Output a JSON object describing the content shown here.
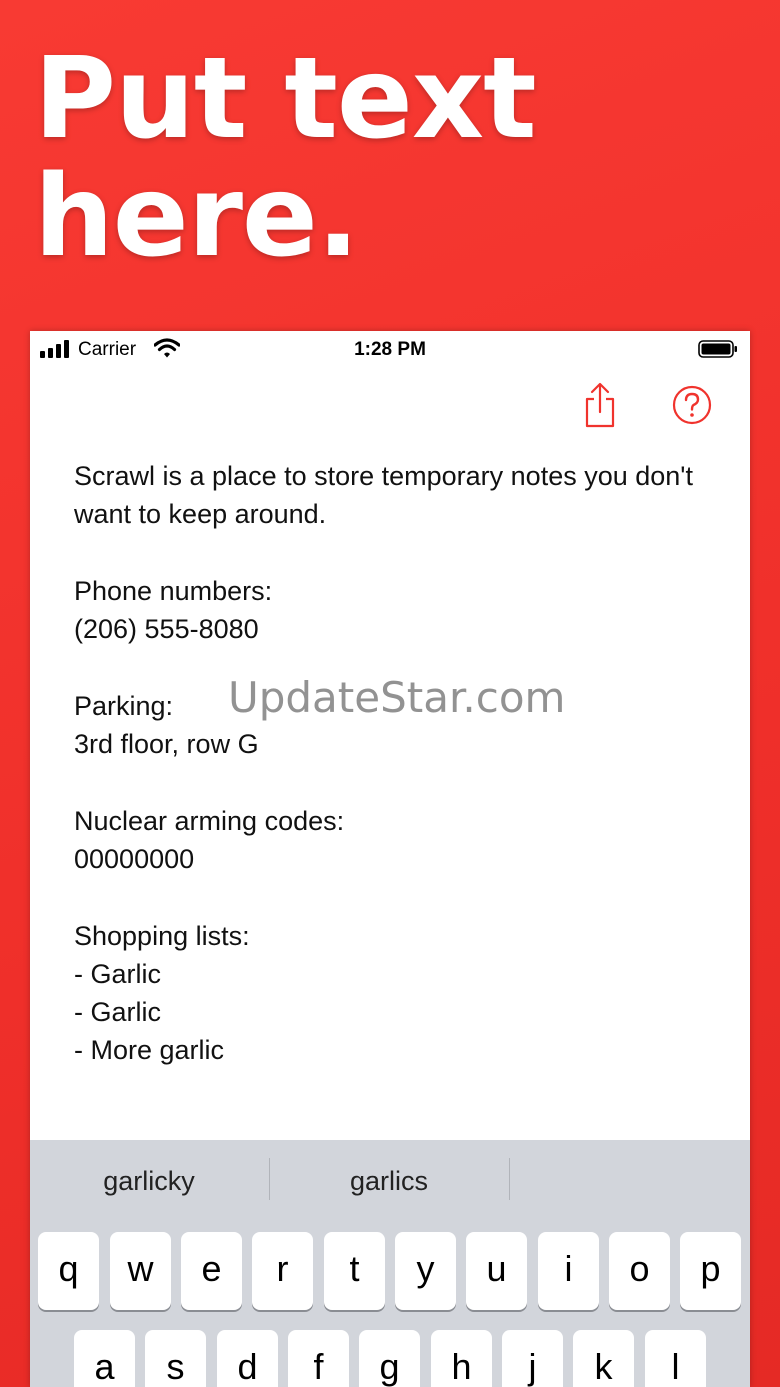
{
  "headline": {
    "line1": "Put text",
    "line2": "here."
  },
  "status_bar": {
    "carrier": "Carrier",
    "time": "1:28 PM"
  },
  "toolbar": {
    "share_icon": "share-icon",
    "help_icon": "help-icon"
  },
  "note": {
    "text": "Scrawl is a place to store temporary notes you don't want to keep around.\n\nPhone numbers:\n(206) 555-8080\n\nParking:\n3rd floor, row G\n\nNuclear arming codes:\n00000000\n\nShopping lists:\n- Garlic\n- Garlic\n- More garlic"
  },
  "watermark": "UpdateStar.com",
  "keyboard": {
    "suggestions": [
      "garlicky",
      "garlics",
      ""
    ],
    "row1": [
      "q",
      "w",
      "e",
      "r",
      "t",
      "y",
      "u",
      "i",
      "o",
      "p"
    ],
    "row2": [
      "a",
      "s",
      "d",
      "f",
      "g",
      "h",
      "j",
      "k",
      "l"
    ]
  },
  "colors": {
    "accent": "#f0332d",
    "background": "#f2352f",
    "keyboard_bg": "#d2d5db"
  }
}
